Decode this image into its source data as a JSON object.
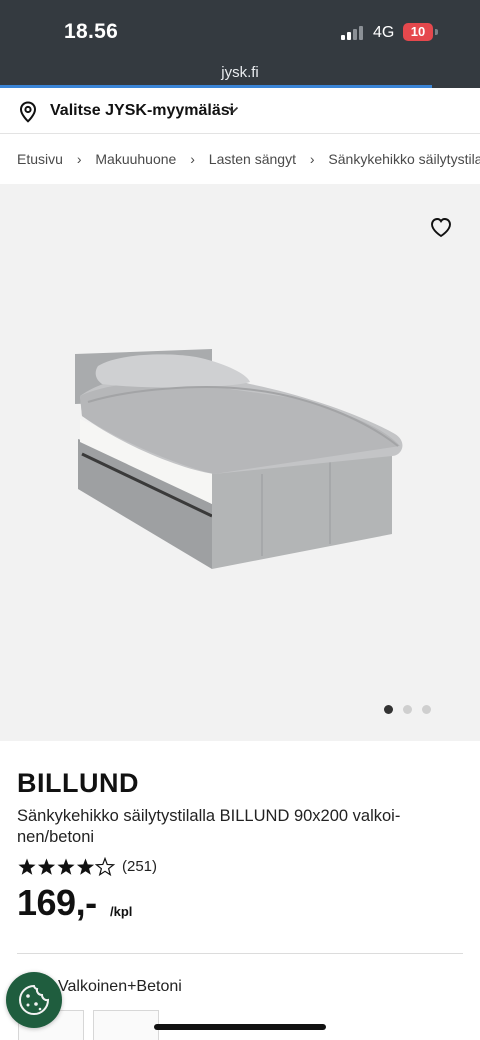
{
  "status_bar": {
    "time": "18.56",
    "network": "4G",
    "battery": "10",
    "battery_color": "#e5484d"
  },
  "browser": {
    "url": "jysk.fi",
    "progress_fraction": 0.9
  },
  "store_picker": {
    "label": "Valitse JYSK-myymäläsi",
    "icon": "location-pin-icon"
  },
  "breadcrumb": [
    "Etusivu",
    "Makuuhuone",
    "Lasten sängyt",
    "Sänkykehikko säilytystilall"
  ],
  "gallery": {
    "image_count": 3,
    "active_index": 0,
    "favorite_icon": "heart-icon"
  },
  "product": {
    "brand": "BILLUND",
    "description": "Sänkykehikko säilytystilalla BILLUND 90x200 valkoi-nen/betoni",
    "rating": 4.5,
    "rating_max": 5,
    "review_count": "(251)",
    "price": "169,-",
    "unit": "/kpl",
    "variant": "Valkoinen+Betoni"
  },
  "colors": {
    "accent_blue": "#3a84d6",
    "cookie_green": "#1f5d3e",
    "topbar": "#343a40"
  }
}
